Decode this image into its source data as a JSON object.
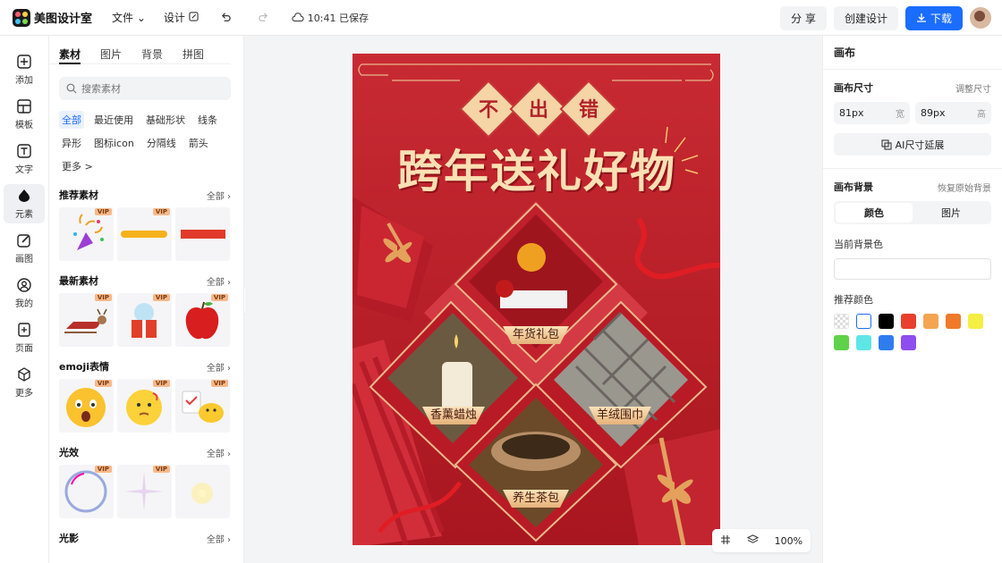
{
  "header": {
    "app_name": "美图设计室",
    "menu_file": "文件",
    "menu_design": "设计",
    "save_status": "10:41 已保存",
    "share_label": "分 享",
    "create_label": "创建设计",
    "download_label": "下载"
  },
  "leftnav": {
    "items": [
      {
        "label": "添加",
        "icon": "plus-square-icon"
      },
      {
        "label": "模板",
        "icon": "template-icon"
      },
      {
        "label": "文字",
        "icon": "text-icon"
      },
      {
        "label": "元素",
        "icon": "element-icon"
      },
      {
        "label": "画图",
        "icon": "draw-icon"
      },
      {
        "label": "我的",
        "icon": "user-icon"
      },
      {
        "label": "页面",
        "icon": "page-icon"
      },
      {
        "label": "更多",
        "icon": "cube-icon"
      }
    ]
  },
  "panel": {
    "tabs": [
      "素材",
      "图片",
      "背景",
      "拼图"
    ],
    "search_placeholder": "搜索素材",
    "chips": [
      "全部",
      "最近使用",
      "基础形状",
      "线条",
      "异形",
      "图标icon",
      "分隔线",
      "箭头",
      "更多 >"
    ],
    "sections": [
      {
        "title": "推荐素材",
        "all": "全部"
      },
      {
        "title": "最新素材",
        "all": "全部"
      },
      {
        "title": "emoji表情",
        "all": "全部"
      },
      {
        "title": "光效",
        "all": "全部"
      },
      {
        "title": "光影",
        "all": "全部"
      }
    ],
    "vip_label": "VIP"
  },
  "poster": {
    "badges": [
      "不",
      "出",
      "错"
    ],
    "headline": "跨年送礼好物",
    "labels": [
      "年货礼包",
      "香薰蜡烛",
      "羊绒围巾",
      "养生茶包"
    ]
  },
  "canvas_toolbar": {
    "zoom": "100%"
  },
  "rightpanel": {
    "title": "画布",
    "size_label": "画布尺寸",
    "adjust_size": "调整尺寸",
    "width_value": "81px",
    "width_unit": "宽",
    "height_value": "89px",
    "height_unit": "高",
    "ai_extend": "AI尺寸延展",
    "bg_label": "画布背景",
    "restore_bg": "恢复原始背景",
    "seg_color": "颜色",
    "seg_image": "图片",
    "current_bg": "当前背景色",
    "recommend": "推荐颜色",
    "swatches": [
      "transparent",
      "#ffffff",
      "#000000",
      "#e8402c",
      "#f5a552",
      "#ef7a2a",
      "#f5ee45",
      "#5ed248",
      "#5ee6e6",
      "#2f7cf0",
      "#8e4df0"
    ]
  }
}
